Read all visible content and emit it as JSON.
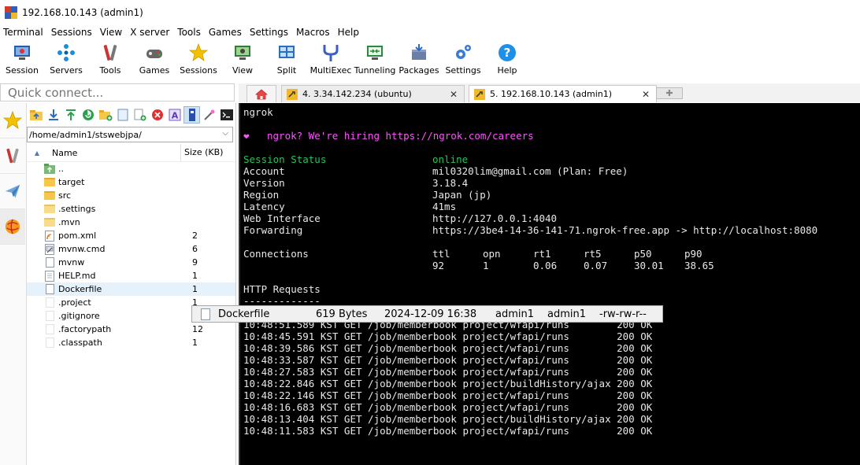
{
  "window": {
    "title": "192.168.10.143 (admin1)"
  },
  "menu": [
    "Terminal",
    "Sessions",
    "View",
    "X server",
    "Tools",
    "Games",
    "Settings",
    "Macros",
    "Help"
  ],
  "toolbar": [
    {
      "label": "Session",
      "icon": "session-icon"
    },
    {
      "label": "Servers",
      "icon": "servers-icon"
    },
    {
      "label": "Tools",
      "icon": "tools-icon"
    },
    {
      "label": "Games",
      "icon": "games-icon"
    },
    {
      "label": "Sessions",
      "icon": "star-icon"
    },
    {
      "label": "View",
      "icon": "view-icon"
    },
    {
      "label": "Split",
      "icon": "split-icon"
    },
    {
      "label": "MultiExec",
      "icon": "multiexec-icon"
    },
    {
      "label": "Tunneling",
      "icon": "tunneling-icon"
    },
    {
      "label": "Packages",
      "icon": "packages-icon"
    },
    {
      "label": "Settings",
      "icon": "settings-icon"
    },
    {
      "label": "Help",
      "icon": "help-icon"
    }
  ],
  "quick_connect": {
    "placeholder": "Quick connect..."
  },
  "tabs": [
    {
      "label": "4. 3.34.142.234 (ubuntu)"
    },
    {
      "label": "5. 192.168.10.143 (admin1)"
    }
  ],
  "file_browser": {
    "path": "/home/admin1/stswebjpa/",
    "col_name": "Name",
    "col_size": "Size (KB)",
    "items": [
      {
        "name": "..",
        "size": "",
        "type": "up"
      },
      {
        "name": "target",
        "size": "",
        "type": "folder"
      },
      {
        "name": "src",
        "size": "",
        "type": "folder"
      },
      {
        "name": ".settings",
        "size": "",
        "type": "folder-light"
      },
      {
        "name": ".mvn",
        "size": "",
        "type": "folder-light"
      },
      {
        "name": "pom.xml",
        "size": "2",
        "type": "file"
      },
      {
        "name": "mvnw.cmd",
        "size": "6",
        "type": "file"
      },
      {
        "name": "mvnw",
        "size": "9",
        "type": "file"
      },
      {
        "name": "HELP.md",
        "size": "1",
        "type": "file"
      },
      {
        "name": "Dockerfile",
        "size": "1",
        "type": "file"
      },
      {
        "name": ".project",
        "size": "1",
        "type": "file"
      },
      {
        "name": ".gitignore",
        "size": "1",
        "type": "file"
      },
      {
        "name": ".factorypath",
        "size": "12",
        "type": "file"
      },
      {
        "name": ".classpath",
        "size": "1",
        "type": "file"
      }
    ]
  },
  "terminal": {
    "cmd": "ngrok",
    "hiring_heart": "❤",
    "hiring": "ngrok? We're hiring https://ngrok.com/careers",
    "status_label": "Session Status",
    "status_value": "online",
    "fields": [
      {
        "k": "Account",
        "v": "mil0320lim@gmail.com (Plan: Free)"
      },
      {
        "k": "Version",
        "v": "3.18.4"
      },
      {
        "k": "Region",
        "v": "Japan (jp)"
      },
      {
        "k": "Latency",
        "v": "41ms"
      },
      {
        "k": "Web Interface",
        "v": "http://127.0.0.1:4040"
      },
      {
        "k": "Forwarding",
        "v": "https://3be4-14-36-141-71.ngrok-free.app -> http://localhost:8080"
      }
    ],
    "connections_label": "Connections",
    "conn_headers": [
      "ttl",
      "opn",
      "rt1",
      "rt5",
      "p50",
      "p90"
    ],
    "conn_values": [
      "92",
      "1",
      "0.06",
      "0.07",
      "30.01",
      "38.65"
    ],
    "http_label": "HTTP Requests",
    "http_sep": "-------------",
    "requests": [
      "10:48:51.589 KST GET /job/memberbook project/wfapi/runs        200 OK",
      "10:48:45.591 KST GET /job/memberbook project/wfapi/runs        200 OK",
      "10:48:39.586 KST GET /job/memberbook project/wfapi/runs        200 OK",
      "10:48:33.587 KST GET /job/memberbook project/wfapi/runs        200 OK",
      "10:48:27.583 KST GET /job/memberbook project/wfapi/runs        200 OK",
      "10:48:22.846 KST GET /job/memberbook project/buildHistory/ajax 200 OK",
      "10:48:22.146 KST GET /job/memberbook project/wfapi/runs        200 OK",
      "10:48:16.683 KST GET /job/memberbook project/wfapi/runs        200 OK",
      "10:48:13.404 KST GET /job/memberbook project/buildHistory/ajax 200 OK",
      "10:48:11.583 KST GET /job/memberbook project/wfapi/runs        200 OK"
    ]
  },
  "tooltip": {
    "name": "Dockerfile",
    "size": "619 Bytes",
    "date": "2024-12-09 16:38",
    "owner": "admin1",
    "group": "admin1",
    "perms": "-rw-rw-r--"
  }
}
